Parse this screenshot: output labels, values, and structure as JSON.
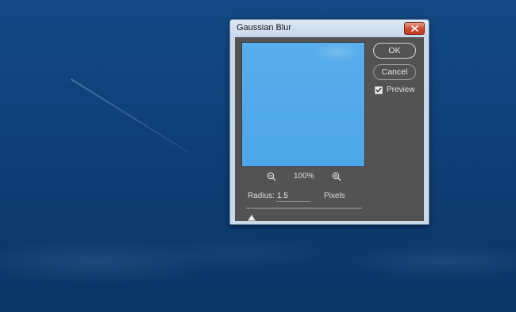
{
  "dialog": {
    "title": "Gaussian Blur",
    "ok_label": "OK",
    "cancel_label": "Cancel",
    "preview_label": "Preview",
    "preview_checked": true
  },
  "zoom": {
    "level": "100%"
  },
  "radius": {
    "label": "Radius:",
    "value": "1.5",
    "unit": "Pixels",
    "slider_fraction": 0.05
  },
  "colors": {
    "panel": "#535353",
    "preview_sky": "#4fa7ea",
    "desktop_sky": "#134a86"
  }
}
